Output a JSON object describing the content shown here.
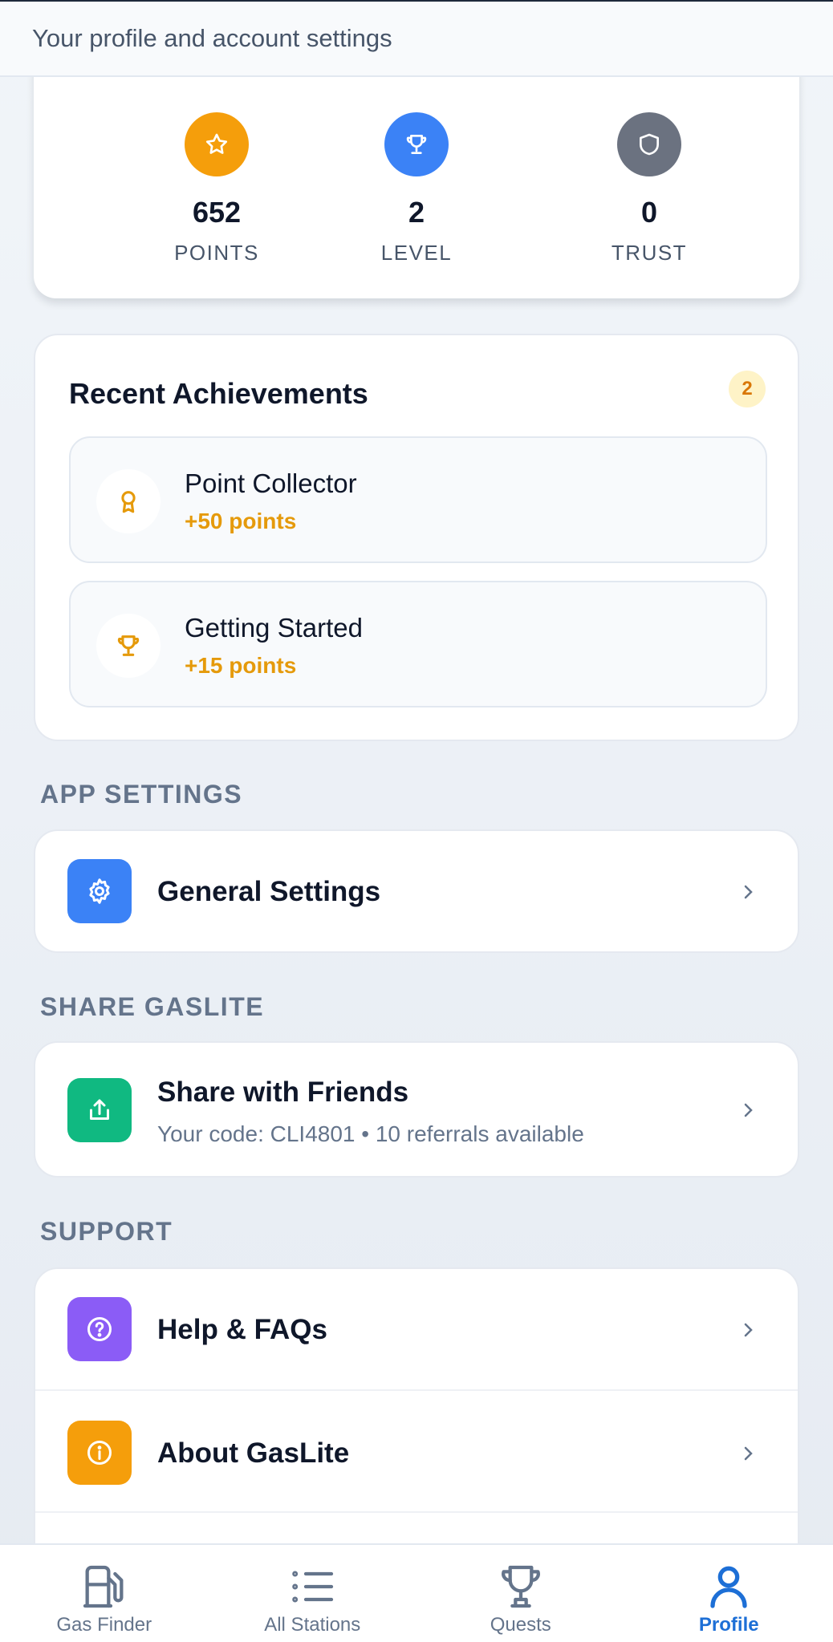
{
  "header": {
    "subtitle": "Your profile and account settings"
  },
  "stats": [
    {
      "value": "652",
      "label": "POINTS",
      "icon": "star-icon",
      "color": "#f59e0b"
    },
    {
      "value": "2",
      "label": "LEVEL",
      "icon": "trophy-icon",
      "color": "#3b82f6"
    },
    {
      "value": "0",
      "label": "TRUST",
      "icon": "shield-icon",
      "color": "#6b7280"
    }
  ],
  "achievements": {
    "title": "Recent Achievements",
    "count": "2",
    "items": [
      {
        "name": "Point Collector",
        "points": "+50 points",
        "icon": "award-ribbon-icon"
      },
      {
        "name": "Getting Started",
        "points": "+15 points",
        "icon": "trophy-icon"
      }
    ]
  },
  "app_settings": {
    "header": "APP SETTINGS",
    "items": [
      {
        "title": "General Settings",
        "icon": "gear-icon",
        "color": "#3b82f6"
      }
    ]
  },
  "share": {
    "header": "SHARE GASLITE",
    "items": [
      {
        "title": "Share with Friends",
        "subtitle": "Your code: CLI4801 • 10 referrals available",
        "icon": "share-icon",
        "color": "#10b981"
      }
    ]
  },
  "support": {
    "header": "SUPPORT",
    "items": [
      {
        "title": "Help & FAQs",
        "icon": "question-icon",
        "color": "#8b5cf6"
      },
      {
        "title": "About GasLite",
        "icon": "info-icon",
        "color": "#f59e0b"
      }
    ]
  },
  "bottom_nav": {
    "items": [
      {
        "label": "Gas Finder",
        "icon": "fuel-pump-icon",
        "active": false
      },
      {
        "label": "All Stations",
        "icon": "list-icon",
        "active": false
      },
      {
        "label": "Quests",
        "icon": "trophy-icon",
        "active": false
      },
      {
        "label": "Profile",
        "icon": "user-icon",
        "active": true
      }
    ],
    "active_color": "#1d6fd6"
  }
}
